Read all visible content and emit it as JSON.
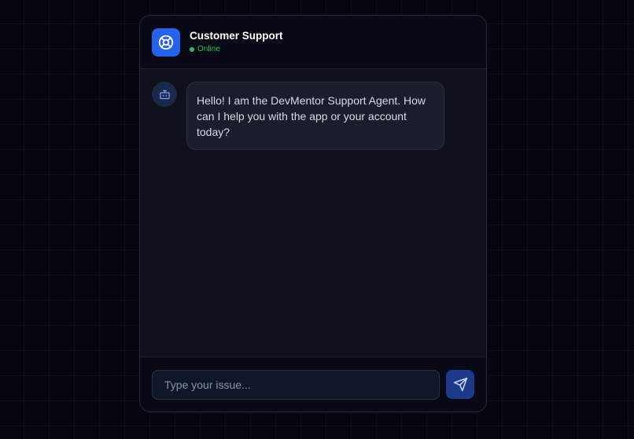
{
  "header": {
    "title": "Customer Support",
    "status": "Online",
    "icon": "lifebuoy-icon"
  },
  "messages": [
    {
      "sender": "bot",
      "avatar_icon": "bot-icon",
      "text": "Hello! I am the DevMentor Support Agent. How can I help you with the app or your account today?"
    }
  ],
  "input": {
    "placeholder": "Type your issue...",
    "value": ""
  },
  "send_button": {
    "icon": "send-icon"
  },
  "colors": {
    "page_background": "#04060d",
    "accent": "#2563eb",
    "status_online": "#22c55e",
    "send_button": "#1d3a8a",
    "bubble": "#1a1e2b"
  }
}
